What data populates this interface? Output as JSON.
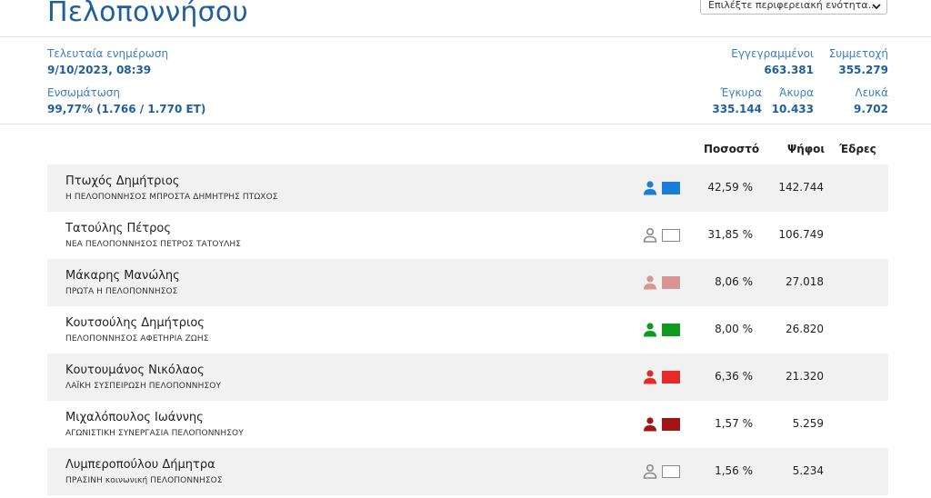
{
  "header": {
    "title": "Πελοποννήσου",
    "region_select": {
      "selected": "Επιλέξτε περιφερειακή ενότητα..."
    }
  },
  "stats": {
    "last_update_label": "Τελευταία ενημέρωση",
    "last_update_value": "9/10/2023, 08:39",
    "integration_label": "Ενσωμάτωση",
    "integration_value": "99,77% (1.766 / 1.770 ΕΤ)",
    "registered_label": "Εγγεγραμμένοι",
    "registered_value": "663.381",
    "turnout_label": "Συμμετοχή",
    "turnout_value": "355.279",
    "valid_label": "Έγκυρα",
    "valid_value": "335.144",
    "invalid_label": "Άκυρα",
    "invalid_value": "10.433",
    "blank_label": "Λευκά",
    "blank_value": "9.702"
  },
  "table": {
    "headers": {
      "percent": "Ποσοστό",
      "votes": "Ψήφοι",
      "seats": "Έδρες"
    },
    "rows": [
      {
        "candidate": "Πτωχός Δημήτριος",
        "party": "Η ΠΕΛΟΠΟΝΝΗΣΟΣ ΜΠΡΟΣΤΑ ΔΗΜΗΤΡΗΣ ΠΤΩΧΟΣ",
        "percent": "42,59 %",
        "votes": "142.744",
        "color": "#1b7ed6",
        "icon": "person-icon"
      },
      {
        "candidate": "Τατούλης Πέτρος",
        "party": "ΝΕΑ ΠΕΛΟΠΟΝΝΗΣΟΣ ΠΕΤΡΟΣ ΤΑΤΟΥΛΗΣ",
        "percent": "31,85 %",
        "votes": "106.749",
        "color": "#ffffff",
        "icon": "person-outline-icon"
      },
      {
        "candidate": "Μάκαρης Μανώλης",
        "party": "ΠΡΩΤΑ Η ΠΕΛΟΠΟΝΝΗΣΟΣ",
        "percent": "8,06 %",
        "votes": "27.018",
        "color": "#d99595",
        "icon": "person-icon"
      },
      {
        "candidate": "Κουτσούλης Δημήτριος",
        "party": "ΠΕΛΟΠΟΝΝΗΣΟΣ ΑΦΕΤΗΡΙΑ ΖΩΗΣ",
        "percent": "8,00 %",
        "votes": "26.820",
        "color": "#0f9a1f",
        "icon": "person-icon"
      },
      {
        "candidate": "Κουτουμάνος Νικόλαος",
        "party": "ΛΑΪΚΗ ΣΥΣΠΕΙΡΩΣΗ ΠΕΛΟΠΟΝΝΗΣΟΥ",
        "percent": "6,36 %",
        "votes": "21.320",
        "color": "#e52a2a",
        "icon": "person-icon"
      },
      {
        "candidate": "Μιχαλόπουλος Ιωάννης",
        "party": "ΑΓΩΝΙΣΤΙΚΗ ΣΥΝΕΡΓΑΣΙΑ ΠΕΛΟΠΟΝΝΗΣΟΥ",
        "percent": "1,57 %",
        "votes": "5.259",
        "color": "#a01515",
        "icon": "person-icon"
      },
      {
        "candidate": "Λυμπεροπούλου Δήμητρα",
        "party": "ΠΡΑΣΙΝΗ κοινωνική ΠΕΛΟΠΟΝΝΗΣΟΣ",
        "percent": "1,56 %",
        "votes": "5.234",
        "color": "#ffffff",
        "icon": "person-outline-icon"
      }
    ]
  }
}
